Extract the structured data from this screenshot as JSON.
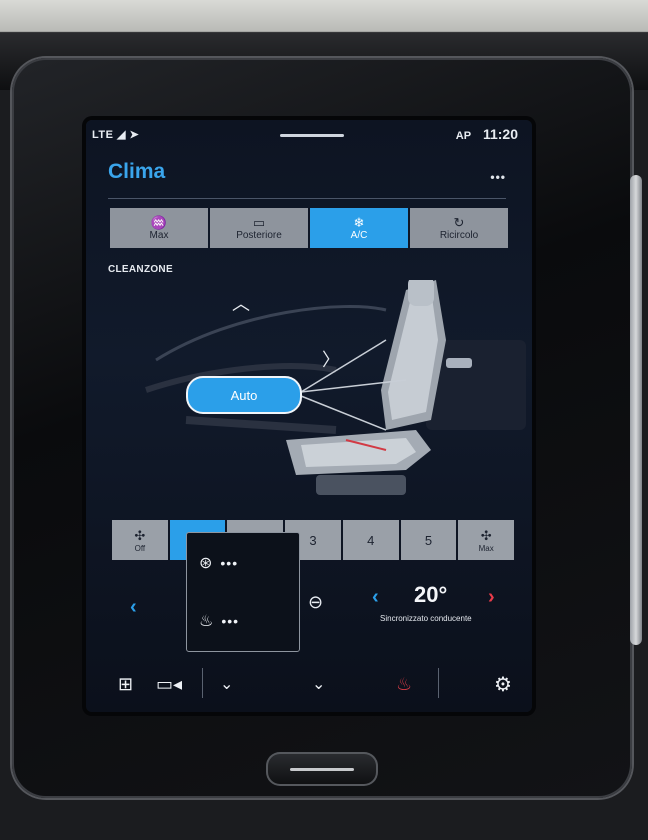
{
  "status": {
    "network": "LTE",
    "ap_label": "AP",
    "time": "11:20"
  },
  "app": {
    "title": "Clima",
    "more_label": "•••"
  },
  "top_buttons": [
    {
      "icon": "windshield-defrost-max-icon",
      "label": "Max",
      "active": false
    },
    {
      "icon": "rear-defrost-icon",
      "label": "Posteriore",
      "active": false
    },
    {
      "icon": "snowflake-icon",
      "label": "A/C",
      "active": true
    },
    {
      "icon": "recirculation-icon",
      "label": "Ricircolo",
      "active": false
    }
  ],
  "cleanzone_label": "CLEANZONE",
  "airflow": {
    "mode_label": "Auto"
  },
  "fan_levels": [
    {
      "label": "Off",
      "active": false
    },
    {
      "label": "",
      "active": true
    },
    {
      "label": "",
      "active": false
    },
    {
      "label": "3",
      "active": false
    },
    {
      "label": "4",
      "active": false
    },
    {
      "label": "5",
      "active": false
    },
    {
      "label": "Max",
      "active": false
    }
  ],
  "popup": {
    "rows": [
      {
        "icon": "heated-steering-wheel-icon",
        "level": "•••"
      },
      {
        "icon": "heated-seat-icon",
        "level": "•••"
      }
    ]
  },
  "driver_temp": {
    "value": "20°",
    "sync_label": "Sincronizzato conducente"
  },
  "accent": "#2b9fe9",
  "bottom_icons": [
    "home-grid-icon",
    "camera-icon",
    "chevron-down-icon",
    "chevron-down-icon",
    "heated-seat-icon",
    "settings-icon"
  ]
}
